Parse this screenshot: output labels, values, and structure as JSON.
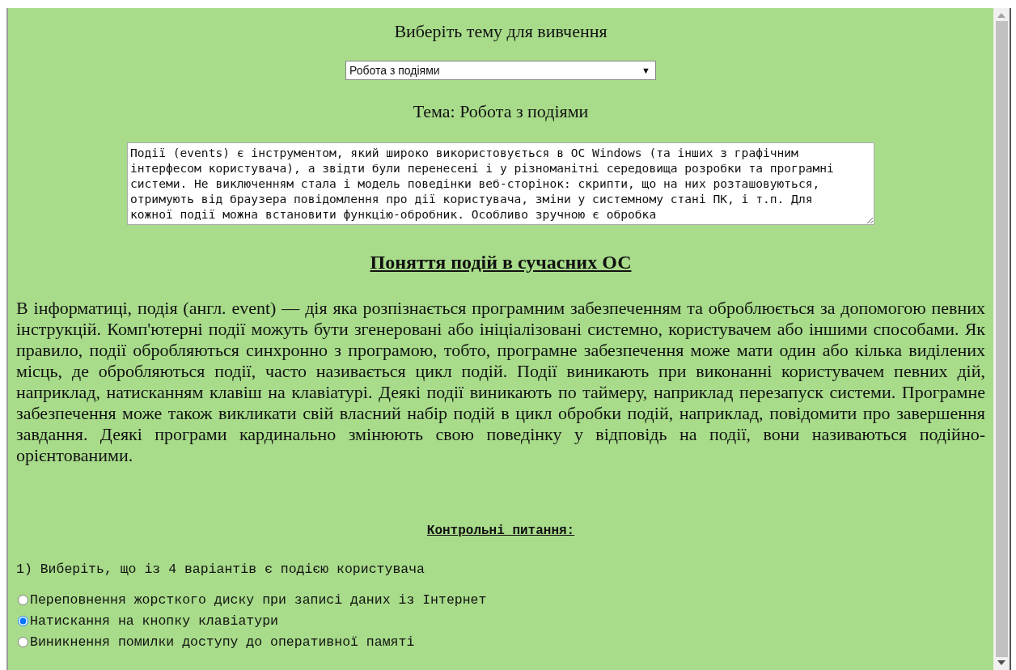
{
  "heading": "Виберіть тему для вивчення",
  "topic_select": {
    "value": "Робота з подіями",
    "caret": "▼"
  },
  "topic_title": "Тема: Робота з подіями",
  "topic_text": "Події (events) є інструментом, який широко використовується в ОС Windows (та інших з графічним інтерфесом користувача), а звідти були перенесені і у різноманітні середовища розробки та програмні системи. Не виключенням стала і модель поведінки веб-сторінок: скрипти, що на них розташовуються, отримують від браузера повідомлення про дії користувача, зміни у системному стані ПК, і т.п. Для кожної події можна встановити функцію-обробник. Особливо зручною є обробка",
  "section_title": "Поняття подій в сучасних ОС",
  "paragraph": "В інформатиці, подія (англ. event) — дія яка розпізнається програмним забезпеченням та оброблюється за допомогою певних інструкцій. Комп'ютерні події можуть бути згенеровані або ініціалізовані системно, користувачем або іншими способами. Як правило, події обробляються синхронно з програмою, тобто, програмне забезпечення може мати один або кілька виділених місць, де обробляються події, часто називається цикл подій. Події виникають при виконанні користувачем певних дій, наприклад, натисканням клавіш на клавіатурі. Деякі події виникають по таймеру, наприклад перезапуск системи. Програмне забезпечення може також викликати свій власний набір подій в цикл обробки подій, наприклад, повідомити про завершення завдання. Деякі програми кардинально змінюють свою поведінку у відповідь на події, вони називаються подійно-орієнтованими.",
  "quiz_title": "Контрольні питання:",
  "questions": [
    {
      "text": "1) Виберіть, що із 4 варіантів є подією користувача",
      "options": [
        {
          "label": "Переповнення жорсткого диску при записі даних із Інтернет",
          "selected": false
        },
        {
          "label": "Натискання на кнопку клавіатури",
          "selected": true
        },
        {
          "label": "Виникнення помилки доступу до оперативної памяті",
          "selected": false
        }
      ]
    }
  ]
}
